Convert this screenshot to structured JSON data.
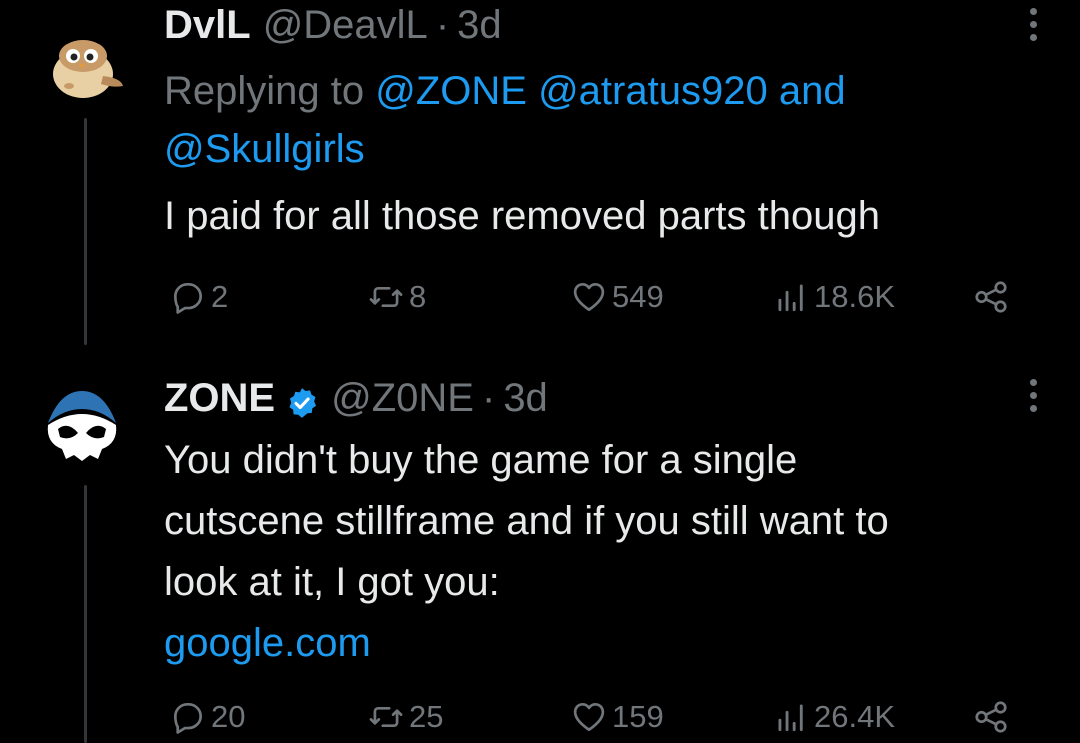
{
  "tweets": [
    {
      "name": "DvlL",
      "handle": "@DeavlL",
      "time": "3d",
      "avatar_icon": "bird-avatar",
      "replying_prefix": "Replying to ",
      "replying_handles": [
        "@ZONE",
        "@atratus920"
      ],
      "replying_and": " and ",
      "replying_last": "@Skullgirls",
      "text": "I paid for all those removed parts though",
      "replies": "2",
      "reposts": "8",
      "likes": "549",
      "views": "18.6K"
    },
    {
      "name": "ZONE",
      "handle": "@Z0NE",
      "time": "3d",
      "verified": true,
      "avatar_icon": "skull-avatar",
      "text_lines": [
        "You didn't buy the game for a single",
        "cutscene stillframe and if you still want to",
        "look at it, I got you:"
      ],
      "link": "google.com",
      "replies": "20",
      "reposts": "25",
      "likes": "159",
      "views": "26.4K"
    }
  ],
  "colors": {
    "background": "#000000",
    "primary_text": "#e7e9ea",
    "secondary_text": "#71767b",
    "link": "#1d9bf0",
    "thread_line": "#333639"
  }
}
